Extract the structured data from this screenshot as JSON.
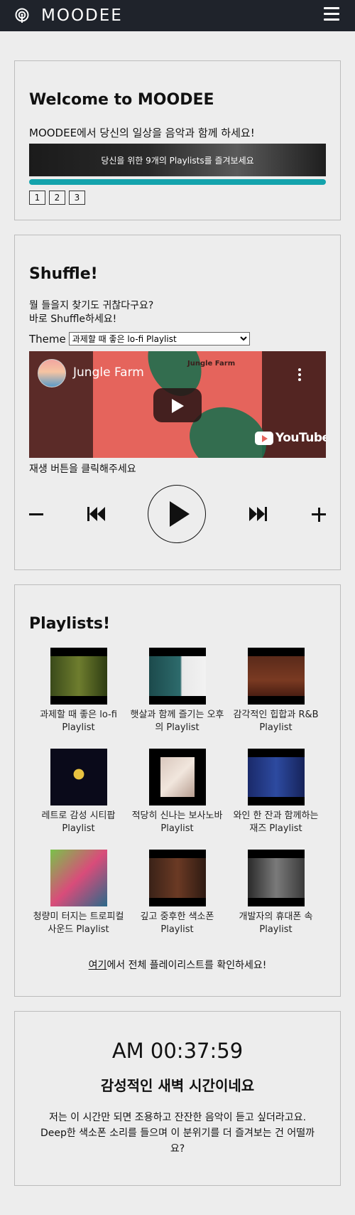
{
  "header": {
    "logo_text": "MOODEE",
    "logo_icon": "broadcast-icon",
    "menu_icon": "hamburger-icon"
  },
  "welcome": {
    "title": "Welcome to MOODEE",
    "lead": "MOODEE에서 당신의 일상을 음악과 함께 하세요!",
    "banner_text": "당신을 위한 9개의 Playlists를 즐겨보세요",
    "pages": [
      "1",
      "2",
      "3"
    ],
    "accent_color": "#14a3ac"
  },
  "shuffle": {
    "title": "Shuffle!",
    "desc_line1": "뭘 들을지 찾기도 귀찮다구요?",
    "desc_line2": "바로 Shuffle하세요!",
    "theme_label": "Theme",
    "theme_selected": "과제할 때 좋은 lo-fi Playlist",
    "video": {
      "channel_title": "Jungle Farm",
      "overlay_text": "Jungle Farm",
      "brand": "YouTube"
    },
    "play_note": "재생 버튼을 클릭해주세요",
    "controls": [
      "minus-icon",
      "previous-track-icon",
      "play-icon",
      "next-track-icon",
      "plus-icon"
    ]
  },
  "playlists": {
    "title": "Playlists!",
    "items": [
      {
        "label": "과제할 때 좋은 lo-fi Playlist"
      },
      {
        "label": "햇살과 함께 즐기는 오후의 Playlist"
      },
      {
        "label": "감각적인 힙합과 R&B Playlist"
      },
      {
        "label": "레트로 감성 시티팝 Playlist"
      },
      {
        "label": "적당히 신나는 보사노바 Playlist"
      },
      {
        "label": "와인 한 잔과 함께하는 재즈 Playlist"
      },
      {
        "label": "청량미 터지는 트로피컬 사운드 Playlist"
      },
      {
        "label": "깊고 중후한 색소폰 Playlist"
      },
      {
        "label": "개발자의 휴대폰 속 Playlist"
      }
    ],
    "footer_link": "여기",
    "footer_text": "에서 전체 플레이리스트를 확인하세요!"
  },
  "clock": {
    "time": "AM 00:37:59",
    "heading": "감성적인 새벽 시간이네요",
    "desc": "저는 이 시간만 되면 조용하고 잔잔한 음악이 듣고 싶더라고요. Deep한 색소폰 소리를 들으며 이 분위기를 더 즐겨보는 건 어떨까요?"
  }
}
